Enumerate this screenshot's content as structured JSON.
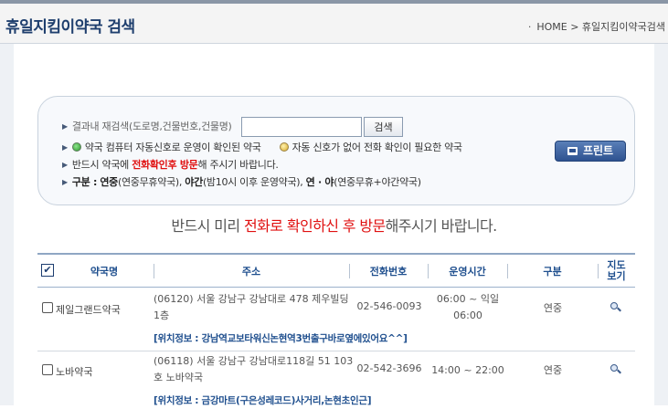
{
  "header": {
    "title": "휴일지킴이약국 검색",
    "breadcrumb_home": "HOME",
    "breadcrumb_sep": ">",
    "breadcrumb_current": "휴일지킴이약국검색"
  },
  "search": {
    "label": "결과내 재검색(도로명,건물번호,건물명)",
    "input_value": "",
    "button_label": "검색",
    "legend_green": "약국 컴퓨터 자동신호로 운영이 확인된 약국",
    "legend_yellow": "자동 신호가 없어 전화 확인이 필요한 약국",
    "notice_prefix": "반드시 약국에 ",
    "notice_red": "전화확인후 방문",
    "notice_suffix": "해 주시기 바랍니다.",
    "type_label": "구분 :",
    "type_a_bold": "연중",
    "type_a_desc": "(연중무휴약국),",
    "type_b_bold": "야간",
    "type_b_desc": "(밤10시 이후 운영약국),",
    "type_c_bold": "연 · 야",
    "type_c_desc": "(연중무휴+야간약국)",
    "print_label": "프린트"
  },
  "notice": {
    "prefix": "반드시 미리 ",
    "red": "전화로 확인하신 후 방문",
    "suffix": "해주시기 바랍니다."
  },
  "table": {
    "headers": {
      "check_mark": "✔",
      "name": "약국명",
      "address": "주소",
      "tel": "전화번호",
      "hours": "운영시간",
      "kind": "구분",
      "map_line1": "지도",
      "map_line2": "보기"
    },
    "rows": [
      {
        "name": "제일그랜드약국",
        "address": "(06120) 서울 강남구 강남대로 478 제우빌딩1층",
        "tel": "02-546-0093",
        "hours": "06:00 ~ 익일 06:00",
        "kind": "연중",
        "info": "[위치정보 : 강남역교보타워신논현역3번출구바로옆에있어요^^]"
      },
      {
        "name": "노바약국",
        "address": "(06118) 서울 강남구 강남대로118길 51 103호 노바약국",
        "tel": "02-542-3696",
        "hours": "14:00 ~ 22:00",
        "kind": "연중",
        "info": "[위치정보 : 금강마트(구은성레코드)사거리,논현초인근]"
      }
    ]
  },
  "colors": {
    "title": "#1f3f6e",
    "accent_red": "#e01010",
    "header_text": "#1f4f8e",
    "print_button": "#3a5f9c"
  }
}
